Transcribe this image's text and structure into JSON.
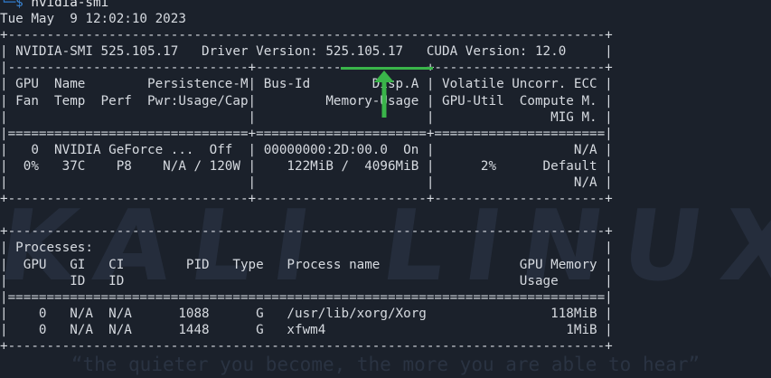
{
  "prompt": {
    "hook": "└─",
    "dollar": "$",
    "command": "nvidia-smi"
  },
  "timestamp": "Tue May  9 12:02:10 2023",
  "smi_table": {
    "top_border": "+-----------------------------------------------------------------------------+",
    "header": "| NVIDIA-SMI 525.105.17   Driver Version: 525.105.17   CUDA Version: 12.0     |",
    "section_border": "|-------------------------------+----------------------+----------------------+",
    "col_header_1": "| GPU  Name        Persistence-M| Bus-Id        Disp.A | Volatile Uncorr. ECC |",
    "col_header_2": "| Fan  Temp  Perf  Pwr:Usage/Cap|         Memory-Usage | GPU-Util  Compute M. |",
    "col_header_3": "|                               |                      |               MIG M. |",
    "double_border": "|===============================+======================+======================|",
    "gpu_row_1": "|   0  NVIDIA GeForce ...  Off  | 00000000:2D:00.0  On |                  N/A |",
    "gpu_row_2": "|  0%   37C    P8    N/A / 120W |    122MiB /  4096MiB |      2%      Default |",
    "gpu_row_3": "|                               |                      |                  N/A |",
    "gpu_bottom_border": "+-------------------------------+----------------------+----------------------+",
    "blank": " ",
    "proc_top_border": "+-----------------------------------------------------------------------------+",
    "proc_title": "| Processes:                                                                  |",
    "proc_header_1": "|  GPU   GI   CI        PID   Type   Process name                  GPU Memory |",
    "proc_header_2": "|        ID   ID                                                   Usage      |",
    "proc_double_border": "|=============================================================================|",
    "proc_row_1": "|    0   N/A  N/A      1088      G   /usr/lib/xorg/Xorg                118MiB |",
    "proc_row_2": "|    0   N/A  N/A      1448      G   xfwm4                               1MiB |",
    "proc_bottom_border": "+-----------------------------------------------------------------------------+"
  },
  "watermark": {
    "logo": "KALI LINUX",
    "quote": "“the quieter you become, the more you are able to hear”"
  },
  "colors": {
    "background": "#1b212b",
    "text": "#d6dae0",
    "prompt_blue": "#3a86d6",
    "highlight_green": "#3ab54a"
  }
}
